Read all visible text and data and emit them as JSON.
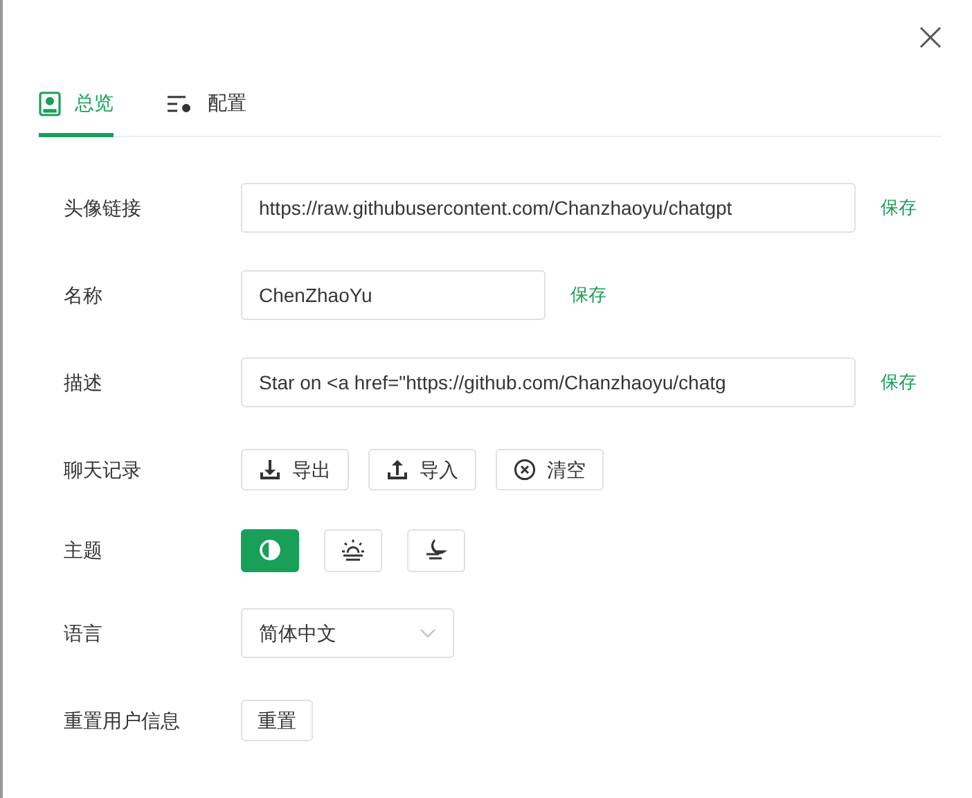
{
  "tabs": [
    {
      "label": "总览",
      "selected": true,
      "kind": "overview"
    },
    {
      "label": "配置",
      "selected": false,
      "kind": "config"
    }
  ],
  "rows": [
    {
      "kind": "wide-input",
      "label": "头像链接",
      "value": "https://raw.githubusercontent.com/Chanzhaoyu/chatgpt",
      "action": "保存"
    },
    {
      "kind": "input",
      "label": "名称",
      "value": "ChenZhaoYu",
      "action": "保存"
    },
    {
      "kind": "wide-input",
      "label": "描述",
      "value": "Star on <a href=\"https://github.com/Chanzhaoyu/chatg",
      "action": "保存"
    },
    {
      "kind": "buttons",
      "label": "聊天记录",
      "buttons": [
        {
          "kind": "download",
          "label": "导出"
        },
        {
          "kind": "upload",
          "label": "导入"
        },
        {
          "kind": "clear",
          "label": "清空"
        }
      ]
    },
    {
      "kind": "theme",
      "label": "主题",
      "options": [
        {
          "kind": "auto",
          "selected": true
        },
        {
          "kind": "sun",
          "selected": false
        },
        {
          "kind": "moon",
          "selected": false
        }
      ]
    },
    {
      "kind": "select",
      "label": "语言",
      "value": "简体中文"
    },
    {
      "kind": "button",
      "label": "重置用户信息",
      "button": "重置"
    }
  ]
}
